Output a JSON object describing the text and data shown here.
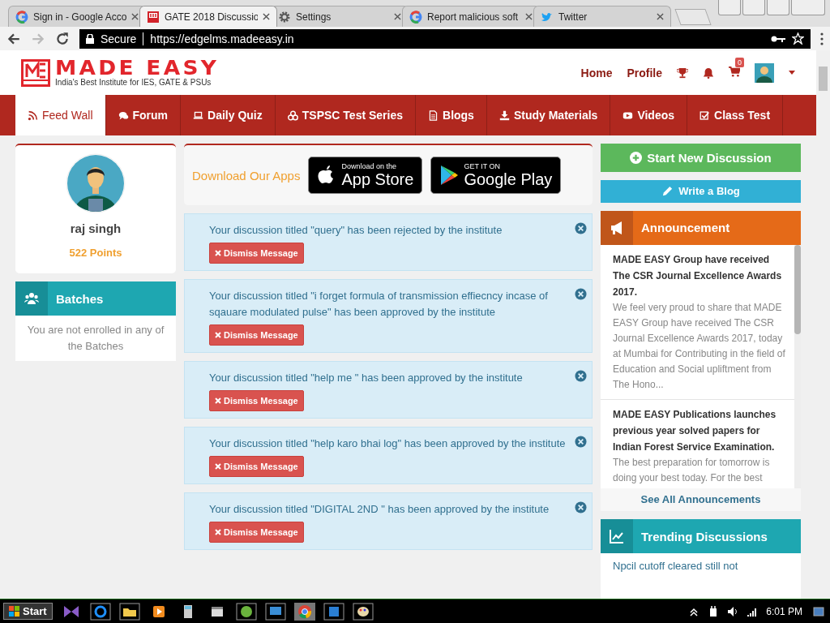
{
  "browser": {
    "tabs": [
      {
        "title": "Sign in - Google Acco",
        "selected": false
      },
      {
        "title": "GATE 2018 Discussio",
        "selected": true
      },
      {
        "title": "Settings",
        "selected": false
      },
      {
        "title": "Report malicious soft",
        "selected": false
      },
      {
        "title": "Twitter",
        "selected": false
      }
    ],
    "secure_label": "Secure",
    "url": "https://edgelms.madeeasy.in"
  },
  "header": {
    "brand": "MADE EASY",
    "tagline": "India's Best Institute for IES, GATE & PSUs",
    "links": [
      "Home",
      "Profile"
    ],
    "cart_count": "0"
  },
  "nav": [
    {
      "label": "Feed Wall",
      "selected": true
    },
    {
      "label": "Forum",
      "selected": false
    },
    {
      "label": "Daily Quiz",
      "selected": false
    },
    {
      "label": "TSPSC Test Series",
      "selected": false
    },
    {
      "label": "Blogs",
      "selected": false
    },
    {
      "label": "Study Materials",
      "selected": false
    },
    {
      "label": "Videos",
      "selected": false
    },
    {
      "label": "Class Test",
      "selected": false
    }
  ],
  "profile": {
    "name": "raj singh",
    "points": "522 Points"
  },
  "batches": {
    "title": "Batches",
    "message": "You are not enrolled in any of the Batches"
  },
  "apps": {
    "title": "Download Our Apps",
    "app_store": {
      "small": "Download on the",
      "big": "App Store"
    },
    "google_play": {
      "small": "GET IT ON",
      "big": "Google Play"
    }
  },
  "messages": [
    {
      "text": "Your discussion titled \"query\" has been rejected by the institute",
      "button": "Dismiss Message"
    },
    {
      "text": "Your discussion titled \"i forget formula of transmission effiecncy incase of sqauare modulated pulse\" has been approved by the institute",
      "button": "Dismiss Message"
    },
    {
      "text": "Your discussion titled \"help me \" has been approved by the institute",
      "button": "Dismiss Message"
    },
    {
      "text": "Your discussion titled \"help karo bhai log\" has been approved by the institute",
      "button": "Dismiss Message"
    },
    {
      "text": "Your discussion titled \"DIGITAL 2ND \" has been approved by the institute",
      "button": "Dismiss Message"
    }
  ],
  "actions": {
    "start": "Start New Discussion",
    "blog": "Write a Blog"
  },
  "announcements": {
    "title": "Announcement",
    "items": [
      {
        "title": "MADE EASY Group have received The CSR Journal Excellence Awards 2017.",
        "body": "We feel very proud to share that MADE EASY Group have received The CSR Journal Excellence Awards 2017, today at Mumbai for Contributing in the field of Education and Social upliftment from The Hono..."
      },
      {
        "title": "MADE EASY Publications launches previous year solved papers for Indian Forest Service Examination.",
        "body": "The best preparation for tomorrow is doing your best today. For the best"
      }
    ],
    "see_all": "See All Announcements"
  },
  "trending": {
    "title": "Trending Discussions",
    "items": [
      "Npcil cutoff cleared still not"
    ]
  },
  "taskbar": {
    "start": "Start",
    "time": "6:01 PM"
  }
}
